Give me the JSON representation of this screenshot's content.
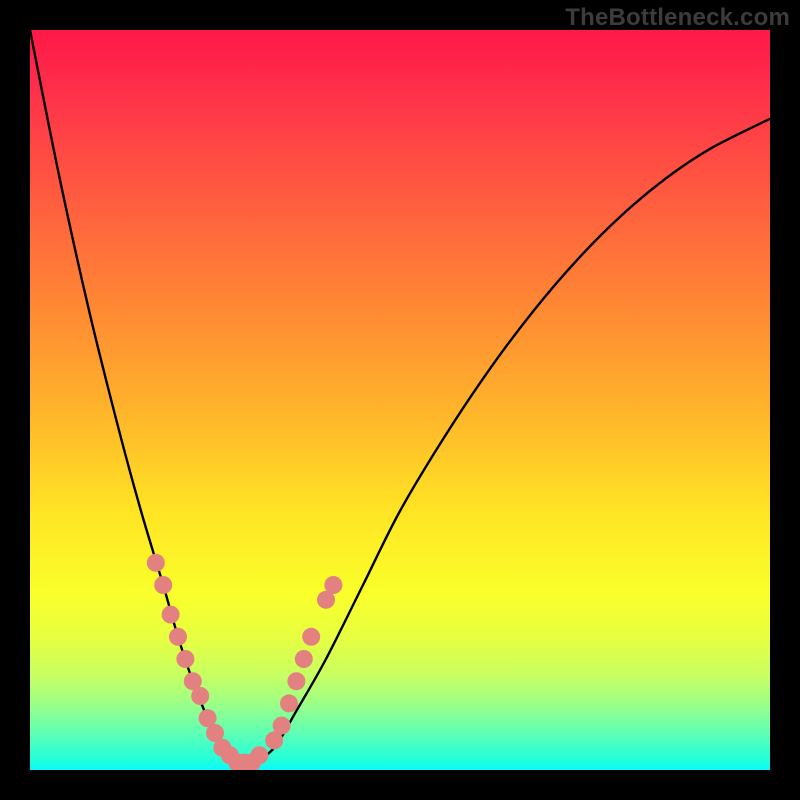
{
  "watermark": {
    "text": "TheBottleneck.com"
  },
  "colors": {
    "background": "#000000",
    "curve_stroke": "#000000",
    "marker_fill": "#e38080",
    "gradient_stops": [
      "#ff1848",
      "#ff2f4a",
      "#ff5a40",
      "#ff8a33",
      "#ffb62a",
      "#ffe424",
      "#faff2a",
      "#e7ff40",
      "#c9ff60",
      "#9dff86",
      "#5fffb4",
      "#1cffdf",
      "#0cf8ff"
    ]
  },
  "chart_data": {
    "type": "line",
    "title": "",
    "xlabel": "",
    "ylabel": "",
    "xlim": [
      0,
      100
    ],
    "ylim": [
      0,
      100
    ],
    "grid": false,
    "legend": false,
    "series": [
      {
        "name": "bottleneck-curve",
        "x": [
          0,
          4,
          8,
          12,
          15,
          18,
          20,
          22,
          24,
          26,
          28,
          30,
          33,
          36,
          40,
          45,
          50,
          56,
          62,
          68,
          74,
          80,
          86,
          92,
          100
        ],
        "y": [
          100,
          80,
          62,
          46,
          35,
          25,
          18,
          12,
          7,
          3,
          1,
          1,
          3,
          8,
          15,
          25,
          35,
          45,
          54,
          62,
          69,
          75,
          80,
          84,
          88
        ]
      }
    ],
    "markers": [
      {
        "series": "bottleneck-curve",
        "x": 17,
        "y": 28
      },
      {
        "series": "bottleneck-curve",
        "x": 18,
        "y": 25
      },
      {
        "series": "bottleneck-curve",
        "x": 19,
        "y": 21
      },
      {
        "series": "bottleneck-curve",
        "x": 20,
        "y": 18
      },
      {
        "series": "bottleneck-curve",
        "x": 21,
        "y": 15
      },
      {
        "series": "bottleneck-curve",
        "x": 22,
        "y": 12
      },
      {
        "series": "bottleneck-curve",
        "x": 23,
        "y": 10
      },
      {
        "series": "bottleneck-curve",
        "x": 24,
        "y": 7
      },
      {
        "series": "bottleneck-curve",
        "x": 25,
        "y": 5
      },
      {
        "series": "bottleneck-curve",
        "x": 26,
        "y": 3
      },
      {
        "series": "bottleneck-curve",
        "x": 27,
        "y": 2
      },
      {
        "series": "bottleneck-curve",
        "x": 28,
        "y": 1
      },
      {
        "series": "bottleneck-curve",
        "x": 29,
        "y": 1
      },
      {
        "series": "bottleneck-curve",
        "x": 30,
        "y": 1
      },
      {
        "series": "bottleneck-curve",
        "x": 31,
        "y": 2
      },
      {
        "series": "bottleneck-curve",
        "x": 33,
        "y": 4
      },
      {
        "series": "bottleneck-curve",
        "x": 34,
        "y": 6
      },
      {
        "series": "bottleneck-curve",
        "x": 35,
        "y": 9
      },
      {
        "series": "bottleneck-curve",
        "x": 36,
        "y": 12
      },
      {
        "series": "bottleneck-curve",
        "x": 37,
        "y": 15
      },
      {
        "series": "bottleneck-curve",
        "x": 38,
        "y": 18
      },
      {
        "series": "bottleneck-curve",
        "x": 40,
        "y": 23
      },
      {
        "series": "bottleneck-curve",
        "x": 41,
        "y": 25
      }
    ]
  }
}
